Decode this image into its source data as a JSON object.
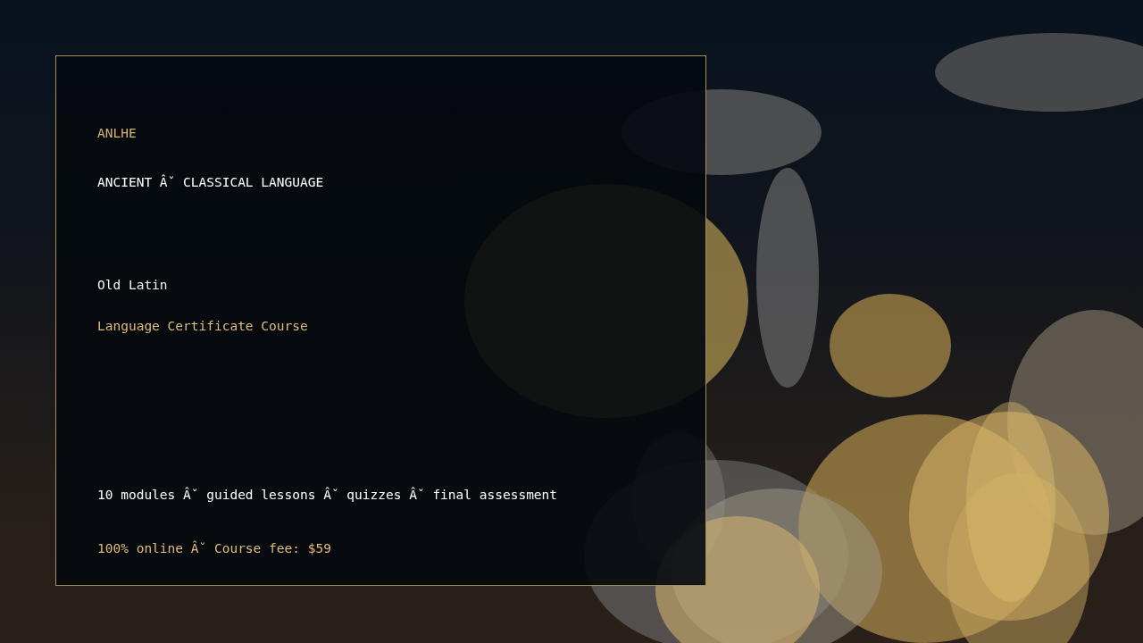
{
  "card": {
    "lines": [
      {
        "kind": "brand",
        "text": "ANLHE"
      },
      {
        "kind": "category",
        "text": "ANCIENT Âˇ CLASSICAL LANGUAGE"
      },
      {
        "kind": "title",
        "text": "Old Latin"
      },
      {
        "kind": "subtitle",
        "text": "Language Certificate Course"
      },
      {
        "kind": "details",
        "text": "10 modules Âˇ guided lessons Âˇ quizzes Âˇ final assessment"
      },
      {
        "kind": "price",
        "text": "100% online Âˇ Course fee: $59"
      }
    ]
  }
}
